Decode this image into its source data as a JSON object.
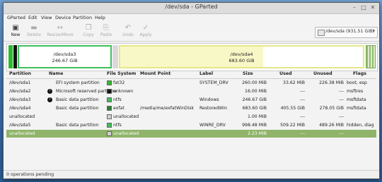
{
  "window": {
    "title": "/dev/sda - GParted"
  },
  "menu": [
    "GParted",
    "Edit",
    "View",
    "Device",
    "Partition",
    "Help"
  ],
  "toolbar": {
    "new": "New",
    "delete": "Delete",
    "resize_move": "Resize/Move",
    "copy": "Copy",
    "paste": "Paste",
    "undo": "Undo",
    "apply": "Apply"
  },
  "device_selector": {
    "value": "/dev/sda   (931.51 GiB)"
  },
  "partition_bar": {
    "sda3": {
      "name": "/dev/sda3",
      "size": "246.67 GiB"
    },
    "sda4": {
      "name": "/dev/sda4",
      "size": "683.60 GiB",
      "used_fraction": 0.59
    }
  },
  "columns": [
    "Partition",
    "Name",
    "File System",
    "Mount Point",
    "Label",
    "Size",
    "Used",
    "Unused",
    "Flags"
  ],
  "rows": [
    {
      "partition": "/dev/sda1",
      "name": "EFI system partition",
      "fs": "fat32",
      "fs_color": "#2db82d",
      "mount": "",
      "label": "SYSTEM_DRV",
      "size": "260.00 MiB",
      "used": "33.62 MiB",
      "unused": "226.38 MiB",
      "flags": "boot, esp",
      "warn": false
    },
    {
      "partition": "/dev/sda2",
      "name": "Microsoft reserved partition",
      "fs": "unknown",
      "fs_color": "#111111",
      "mount": "",
      "label": "",
      "size": "16.00 MiB",
      "used": "---",
      "unused": "---",
      "flags": "msftres",
      "warn": true
    },
    {
      "partition": "/dev/sda3",
      "name": "Basic data partition",
      "fs": "ntfs",
      "fs_color": "#3fbf5a",
      "mount": "",
      "label": "Windows",
      "size": "246.67 GiB",
      "used": "---",
      "unused": "---",
      "flags": "msftdata",
      "warn": true
    },
    {
      "partition": "/dev/sda4",
      "name": "Basic data partition",
      "fs": "exfat",
      "fs_color": "#2e7d32",
      "mount": "/media/me/exfatWinDisk",
      "label": "RestoredWin",
      "size": "683.60 GiB",
      "used": "405.55 GiB",
      "unused": "278.05 GiB",
      "flags": "msftdata",
      "warn": false
    },
    {
      "partition": "unallocated",
      "name": "",
      "fs": "unallocated",
      "fs_color": "#d0d0d0",
      "mount": "",
      "label": "",
      "size": "1.00 MiB",
      "used": "---",
      "unused": "---",
      "flags": "",
      "warn": false
    },
    {
      "partition": "/dev/sda5",
      "name": "Basic data partition",
      "fs": "ntfs",
      "fs_color": "#3fbf5a",
      "mount": "",
      "label": "WINRE_DRV",
      "size": "998.48 MiB",
      "used": "509.22 MiB",
      "unused": "489.26 MiB",
      "flags": "hidden, diag",
      "warn": false
    },
    {
      "partition": "unallocated",
      "name": "",
      "fs": "unallocated",
      "fs_color": "#d0d0d0",
      "mount": "",
      "label": "",
      "size": "2.23 MiB",
      "used": "---",
      "unused": "---",
      "flags": "",
      "warn": false,
      "selected": true
    }
  ],
  "status": {
    "text": "0 operations pending"
  }
}
